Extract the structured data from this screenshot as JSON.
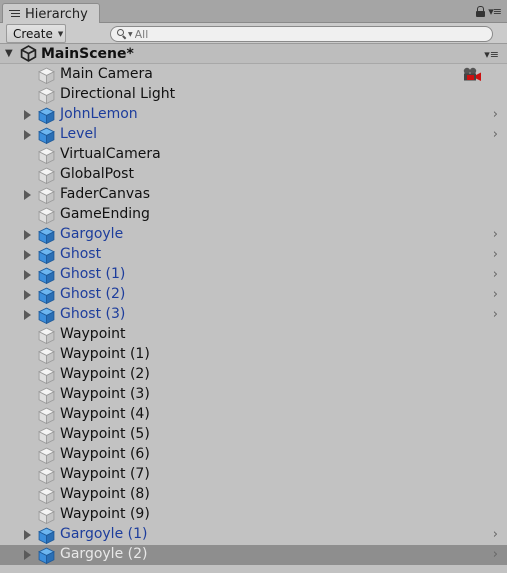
{
  "tab": {
    "title": "Hierarchy"
  },
  "toolbar": {
    "create_label": "Create",
    "search_placeholder": "All"
  },
  "scene": {
    "name": "MainScene*"
  },
  "items": [
    {
      "label": "Main Camera",
      "prefab": false,
      "expandable": false,
      "chevron": false,
      "icon": "gameobject-cube-icon",
      "gizmo": "camera-gizmo-icon"
    },
    {
      "label": "Directional Light",
      "prefab": false,
      "expandable": false,
      "chevron": false,
      "icon": "gameobject-cube-icon"
    },
    {
      "label": "JohnLemon",
      "prefab": true,
      "expandable": true,
      "chevron": true,
      "icon": "prefab-cube-icon"
    },
    {
      "label": "Level",
      "prefab": true,
      "expandable": true,
      "chevron": true,
      "icon": "prefab-cube-icon"
    },
    {
      "label": "VirtualCamera",
      "prefab": false,
      "expandable": false,
      "chevron": false,
      "icon": "gameobject-cube-icon"
    },
    {
      "label": "GlobalPost",
      "prefab": false,
      "expandable": false,
      "chevron": false,
      "icon": "gameobject-cube-icon"
    },
    {
      "label": "FaderCanvas",
      "prefab": false,
      "expandable": true,
      "chevron": false,
      "icon": "gameobject-cube-icon"
    },
    {
      "label": "GameEnding",
      "prefab": false,
      "expandable": false,
      "chevron": false,
      "icon": "gameobject-cube-icon"
    },
    {
      "label": "Gargoyle",
      "prefab": true,
      "expandable": true,
      "chevron": true,
      "icon": "prefab-cube-icon"
    },
    {
      "label": "Ghost",
      "prefab": true,
      "expandable": true,
      "chevron": true,
      "icon": "prefab-cube-icon"
    },
    {
      "label": "Ghost (1)",
      "prefab": true,
      "expandable": true,
      "chevron": true,
      "icon": "prefab-cube-icon"
    },
    {
      "label": "Ghost (2)",
      "prefab": true,
      "expandable": true,
      "chevron": true,
      "icon": "prefab-cube-icon"
    },
    {
      "label": "Ghost (3)",
      "prefab": true,
      "expandable": true,
      "chevron": true,
      "icon": "prefab-cube-icon"
    },
    {
      "label": "Waypoint",
      "prefab": false,
      "expandable": false,
      "chevron": false,
      "icon": "gameobject-cube-icon"
    },
    {
      "label": "Waypoint (1)",
      "prefab": false,
      "expandable": false,
      "chevron": false,
      "icon": "gameobject-cube-icon"
    },
    {
      "label": "Waypoint (2)",
      "prefab": false,
      "expandable": false,
      "chevron": false,
      "icon": "gameobject-cube-icon"
    },
    {
      "label": "Waypoint (3)",
      "prefab": false,
      "expandable": false,
      "chevron": false,
      "icon": "gameobject-cube-icon"
    },
    {
      "label": "Waypoint (4)",
      "prefab": false,
      "expandable": false,
      "chevron": false,
      "icon": "gameobject-cube-icon"
    },
    {
      "label": "Waypoint (5)",
      "prefab": false,
      "expandable": false,
      "chevron": false,
      "icon": "gameobject-cube-icon"
    },
    {
      "label": "Waypoint (6)",
      "prefab": false,
      "expandable": false,
      "chevron": false,
      "icon": "gameobject-cube-icon"
    },
    {
      "label": "Waypoint (7)",
      "prefab": false,
      "expandable": false,
      "chevron": false,
      "icon": "gameobject-cube-icon"
    },
    {
      "label": "Waypoint (8)",
      "prefab": false,
      "expandable": false,
      "chevron": false,
      "icon": "gameobject-cube-icon"
    },
    {
      "label": "Waypoint (9)",
      "prefab": false,
      "expandable": false,
      "chevron": false,
      "icon": "gameobject-cube-icon"
    },
    {
      "label": "Gargoyle (1)",
      "prefab": true,
      "expandable": true,
      "chevron": true,
      "icon": "prefab-cube-icon"
    },
    {
      "label": "Gargoyle (2)",
      "prefab": true,
      "expandable": true,
      "chevron": true,
      "icon": "prefab-cube-icon",
      "selected": true
    }
  ],
  "colors": {
    "panel_bg": "#c2c2c2",
    "prefab_text": "#1d3d9c",
    "selection_bg": "#8e8e8e",
    "prefab_cube": "#3d8fdc",
    "gameobject_cube": "#e8e8e8"
  }
}
